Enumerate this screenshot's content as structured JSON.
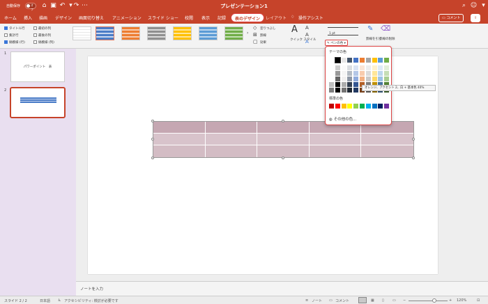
{
  "titlebar": {
    "autosave_label": "自動保存",
    "autosave_state": "オフ",
    "doc_title": "プレゼンテーション1",
    "bg_color": "#c6432a"
  },
  "menu": {
    "tabs": [
      "ホーム",
      "挿入",
      "描画",
      "デザイン",
      "画面切り替え",
      "アニメーション",
      "スライド ショー",
      "校閲",
      "表示",
      "記録"
    ],
    "active_tab": "表のデザイン",
    "layout_tab": "レイアウト",
    "assist": "操作アシスト",
    "comment": "コメント"
  },
  "ribbon": {
    "options_col1": [
      "タイトル行",
      "集計行",
      "縞模様 (行)"
    ],
    "options_col2": [
      "最初の列",
      "最後の列",
      "縞模様 (列)"
    ],
    "options_checked": [
      true,
      false,
      true,
      false,
      false,
      false
    ],
    "fill": "塗りつぶし",
    "border": "罫線",
    "effect": "効果",
    "quick_style": "クイック スタイル",
    "pen_weight": "1 pt",
    "pen_color": "ペンの色",
    "draw_table": "罫線を引く",
    "eraser": "罫線の削除"
  },
  "slides": [
    {
      "num": "1",
      "title": "パワーポイント　表"
    },
    {
      "num": "2",
      "title": ""
    }
  ],
  "popup": {
    "theme_colors_label": "テーマの色",
    "standard_colors_label": "標準の色",
    "more_colors": "その他の色...",
    "tooltip": "オレンジ、アクセント 2、白 + 基本色 40%",
    "theme_top_row": [
      "#ffffff",
      "#000000",
      "#e7e6e6",
      "#44546a",
      "#4472c4",
      "#ed7d31",
      "#a5a5a5",
      "#ffc000",
      "#5b9bd5",
      "#70ad47"
    ],
    "standard_colors": [
      "#c00000",
      "#ff0000",
      "#ffc000",
      "#ffff00",
      "#92d050",
      "#00b050",
      "#00b0f0",
      "#0070c0",
      "#002060",
      "#7030a0"
    ]
  },
  "notes_placeholder": "ノートを入力",
  "status": {
    "slide_info": "スライド 2 / 2",
    "language": "日本語",
    "accessibility": "アクセシビリティ: 検討が必要です",
    "notes": "ノート",
    "comments": "コメント",
    "zoom": "120%"
  }
}
